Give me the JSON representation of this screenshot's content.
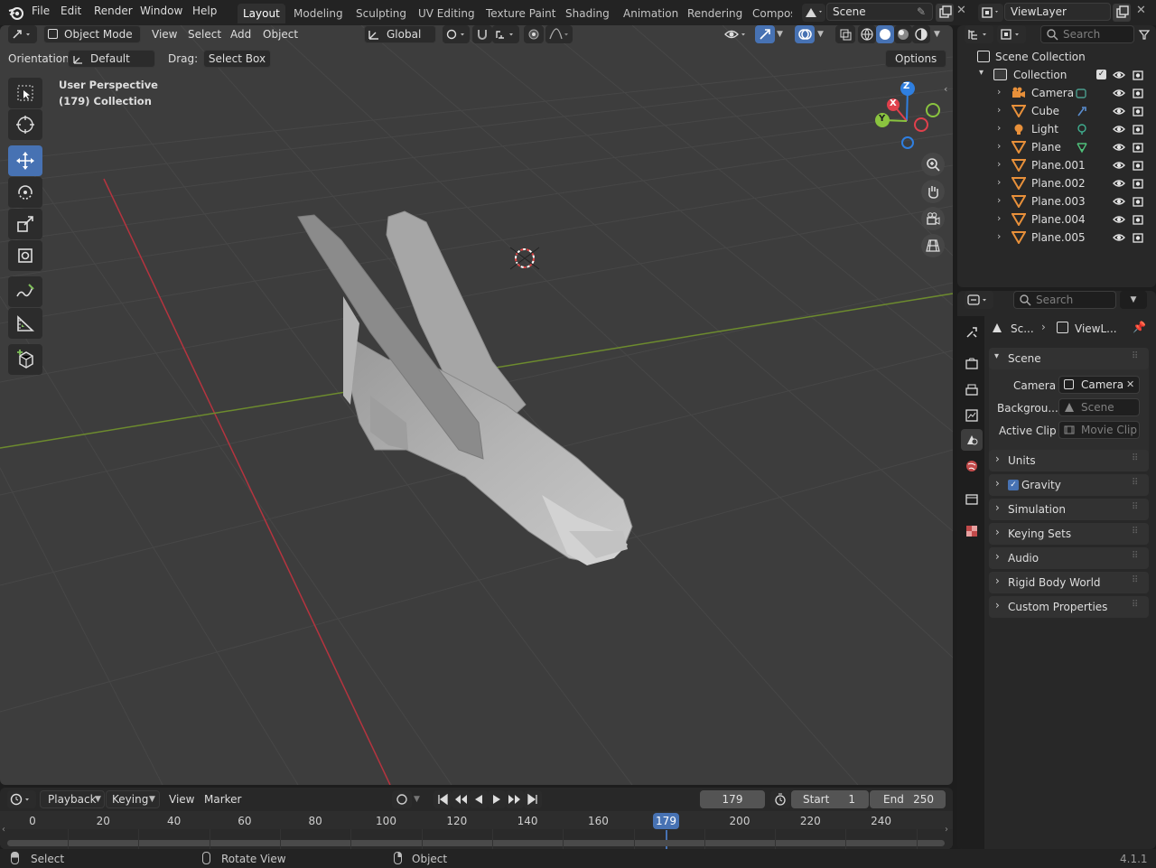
{
  "app": {
    "version": "4.1.1"
  },
  "menu": [
    "File",
    "Edit",
    "Render",
    "Window",
    "Help"
  ],
  "workspaces": [
    {
      "label": "Layout",
      "active": true
    },
    {
      "label": "Modeling"
    },
    {
      "label": "Sculpting"
    },
    {
      "label": "UV Editing"
    },
    {
      "label": "Texture Paint"
    },
    {
      "label": "Shading"
    },
    {
      "label": "Animation"
    },
    {
      "label": "Rendering"
    },
    {
      "label": "Compos"
    }
  ],
  "scene_field": "Scene",
  "viewlayer_field": "ViewLayer",
  "viewport": {
    "mode": "Object Mode",
    "menus": [
      "View",
      "Select",
      "Add",
      "Object"
    ],
    "transform_orientation": "Global",
    "orientation_label": "Orientation:",
    "orientation_value": "Default",
    "drag_label": "Drag:",
    "drag_value": "Select Box",
    "options_label": "Options",
    "overlay_line1": "User Perspective",
    "overlay_line2": "(179) Collection",
    "gizmo_axes": {
      "x": "X",
      "y": "Y",
      "z": "Z"
    }
  },
  "outliner": {
    "search_placeholder": "Search",
    "root": "Scene Collection",
    "collection": "Collection",
    "objects": [
      {
        "name": "Camera",
        "type": "camera"
      },
      {
        "name": "Cube",
        "type": "mesh"
      },
      {
        "name": "Light",
        "type": "light"
      },
      {
        "name": "Plane",
        "type": "mesh"
      },
      {
        "name": "Plane.001",
        "type": "mesh"
      },
      {
        "name": "Plane.002",
        "type": "mesh"
      },
      {
        "name": "Plane.003",
        "type": "mesh"
      },
      {
        "name": "Plane.004",
        "type": "mesh"
      },
      {
        "name": "Plane.005",
        "type": "mesh"
      }
    ]
  },
  "properties": {
    "search_placeholder": "Search",
    "breadcrumb": [
      "Sc...",
      "ViewL..."
    ],
    "scene_panel": "Scene",
    "camera_label": "Camera",
    "camera_value": "Camera",
    "background_label": "Backgrou...",
    "background_placeholder": "Scene",
    "clip_label": "Active Clip",
    "clip_placeholder": "Movie Clip",
    "panels": [
      "Units",
      "Gravity",
      "Simulation",
      "Keying Sets",
      "Audio",
      "Rigid Body World",
      "Custom Properties"
    ],
    "gravity_checked": true
  },
  "timeline": {
    "menus": [
      "Playback",
      "Keying",
      "View",
      "Marker"
    ],
    "current_frame": "179",
    "start_label": "Start",
    "start_value": "1",
    "end_label": "End",
    "end_value": "250",
    "ticks": [
      "0",
      "20",
      "40",
      "60",
      "80",
      "100",
      "120",
      "140",
      "160",
      "180",
      "200",
      "220",
      "240"
    ],
    "current_frame_badge": "179"
  },
  "status": {
    "items": [
      "Select",
      "Rotate View",
      "Object"
    ]
  },
  "colors": {
    "accent": "#4772b3",
    "x_axis": "#e0404c",
    "y_axis": "#8ac43f",
    "z_axis": "#2f7fe0",
    "mesh_icon": "#e8903a"
  }
}
